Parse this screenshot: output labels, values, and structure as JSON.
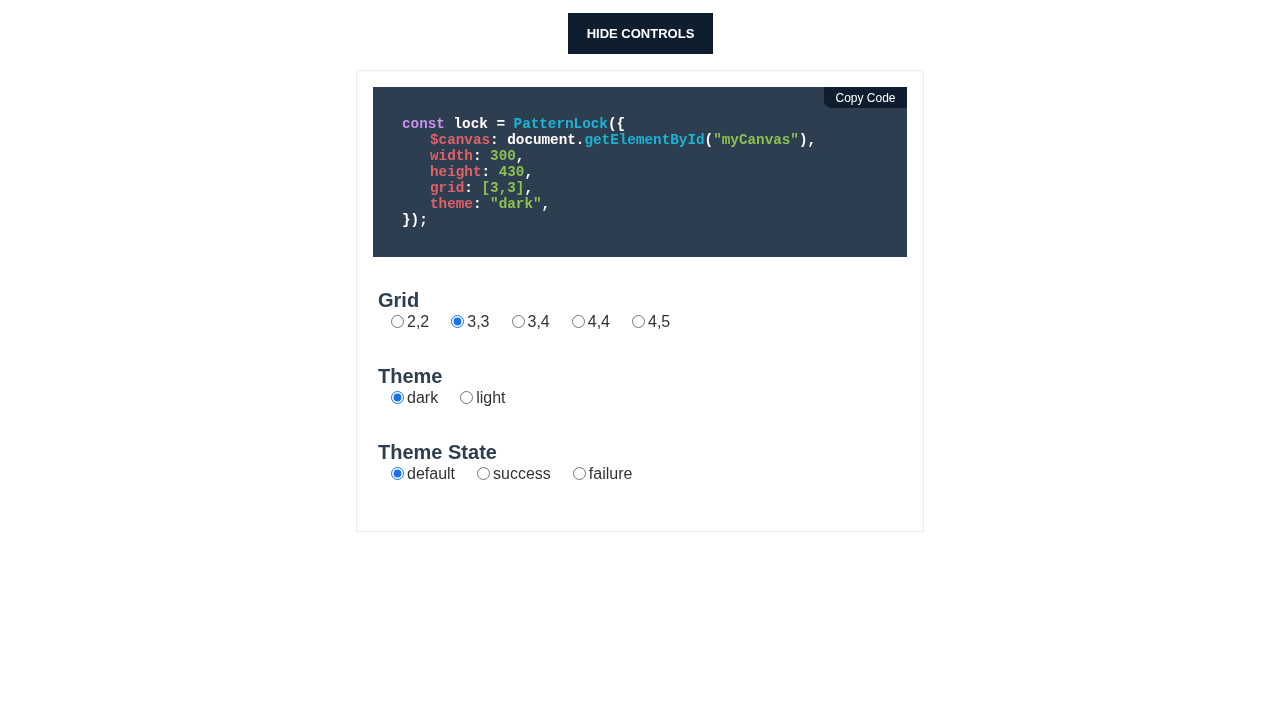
{
  "toggle_button": {
    "label": "HIDE CONTROLS"
  },
  "code_panel": {
    "copy_button": {
      "label": "Copy Code"
    },
    "lines": [
      {
        "tokens": [
          {
            "kind": "keyword",
            "text": "const"
          },
          {
            "kind": "plain",
            "text": " lock = "
          },
          {
            "kind": "function",
            "text": "PatternLock"
          },
          {
            "kind": "plain",
            "text": "({"
          }
        ],
        "children": [
          {
            "tokens": [
              {
                "kind": "property",
                "text": "$canvas"
              },
              {
                "kind": "plain",
                "text": ": document."
              },
              {
                "kind": "function",
                "text": "getElementById"
              },
              {
                "kind": "plain",
                "text": "("
              },
              {
                "kind": "literal",
                "text": "\"myCanvas\""
              },
              {
                "kind": "plain",
                "text": "),"
              }
            ]
          },
          {
            "tokens": [
              {
                "kind": "property",
                "text": "width"
              },
              {
                "kind": "plain",
                "text": ": "
              },
              {
                "kind": "literal",
                "text": "300"
              },
              {
                "kind": "plain",
                "text": ","
              }
            ]
          },
          {
            "tokens": [
              {
                "kind": "property",
                "text": "height"
              },
              {
                "kind": "plain",
                "text": ": "
              },
              {
                "kind": "literal",
                "text": "430"
              },
              {
                "kind": "plain",
                "text": ","
              }
            ]
          },
          {
            "tokens": [
              {
                "kind": "property",
                "text": "grid"
              },
              {
                "kind": "plain",
                "text": ": "
              },
              {
                "kind": "literal",
                "text": "[3,3]"
              },
              {
                "kind": "plain",
                "text": ","
              }
            ]
          },
          {
            "tokens": [
              {
                "kind": "property",
                "text": "theme"
              },
              {
                "kind": "plain",
                "text": ": "
              },
              {
                "kind": "literal",
                "text": "\"dark\""
              },
              {
                "kind": "plain",
                "text": ","
              }
            ]
          }
        ]
      },
      {
        "tokens": [
          {
            "kind": "plain",
            "text": "});"
          }
        ]
      }
    ]
  },
  "settings": [
    {
      "title": "Grid",
      "options": [
        {
          "label": "2,2",
          "selected": false
        },
        {
          "label": "3,3",
          "selected": true
        },
        {
          "label": "3,4",
          "selected": false
        },
        {
          "label": "4,4",
          "selected": false
        },
        {
          "label": "4,5",
          "selected": false
        }
      ]
    },
    {
      "title": "Theme",
      "options": [
        {
          "label": "dark",
          "selected": true
        },
        {
          "label": "light",
          "selected": false
        }
      ]
    },
    {
      "title": "Theme State",
      "options": [
        {
          "label": "default",
          "selected": true
        },
        {
          "label": "success",
          "selected": false
        },
        {
          "label": "failure",
          "selected": false
        }
      ]
    }
  ]
}
